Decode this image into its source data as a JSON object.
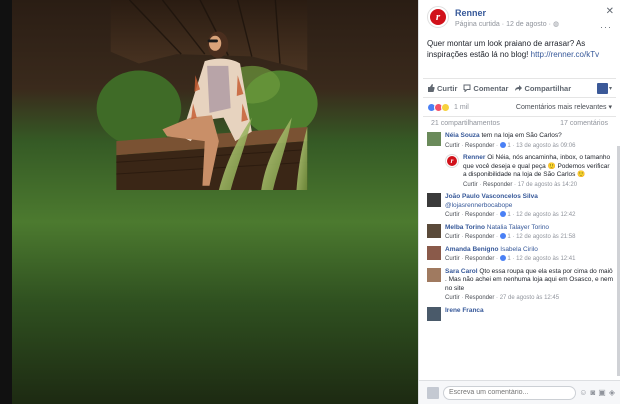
{
  "page": {
    "name": "Renner",
    "category": "Página curtida",
    "date": "12 de agosto",
    "logo_letter": "r"
  },
  "post": {
    "text": "Quer montar um look praiano de arrasar? As inspirações estão lá no blog! ",
    "link": "http://renner.co/kTv"
  },
  "actions": {
    "like": "Curtir",
    "comment": "Comentar",
    "share": "Compartilhar"
  },
  "reactions": {
    "count": "1 mil",
    "sort": "Comentários mais relevantes ▾"
  },
  "stats": {
    "shares": "21 compartilhamentos",
    "comments": "17 comentários"
  },
  "comments": [
    {
      "name": "Néia Souza",
      "tag": "",
      "text": "tem na loja em São Carlos?",
      "like": "Curtir",
      "reply": "Responder",
      "reactions": "1",
      "time": "13 de agosto às 09:06",
      "is_reply": false
    },
    {
      "name": "Renner",
      "tag": "",
      "text": "Oi Néia, nós ancaminha, inbox, o tamanho que você deseja e qual peça 🙂 Podemos verificar a disponibilidade na loja de São Carlos 🙂",
      "like": "Curtir",
      "reply": "Responder",
      "reactions": "",
      "time": "17 de agosto às 14:20",
      "is_reply": true
    },
    {
      "name": "João Paulo Vasconcelos Silva",
      "tag": "",
      "text": "@lojasrennerbocabope",
      "like": "Curtir",
      "reply": "Responder",
      "reactions": "1",
      "time": "12 de agosto às 12:42",
      "is_reply": false
    },
    {
      "name": "Melba Torino",
      "tag": "Natalia Talayer Torino",
      "text": "",
      "like": "Curtir",
      "reply": "Responder",
      "reactions": "1",
      "time": "12 de agosto às 21:58",
      "is_reply": false
    },
    {
      "name": "Amanda Benigno",
      "tag": "Isabela Cirilo",
      "text": "",
      "like": "Curtir",
      "reply": "Responder",
      "reactions": "1",
      "time": "12 de agosto às 12:41",
      "is_reply": false
    },
    {
      "name": "Sara Carol",
      "tag": "",
      "text": "Qto essa roupa que ela esta por cima do maiô . Mas não achei em nenhuma loja aqui em Osasco, e nem no site",
      "like": "Curtir",
      "reply": "Responder",
      "reactions": "",
      "time": "27 de agosto às 12:45",
      "is_reply": false
    },
    {
      "name": "Irene Franca",
      "tag": "",
      "text": "",
      "like": "",
      "reply": "",
      "reactions": "",
      "time": "",
      "is_reply": false
    }
  ],
  "composer": {
    "placeholder": "Escreva um comentário..."
  },
  "colors": {
    "brand_red": "#d1111a",
    "link_blue": "#365899"
  }
}
